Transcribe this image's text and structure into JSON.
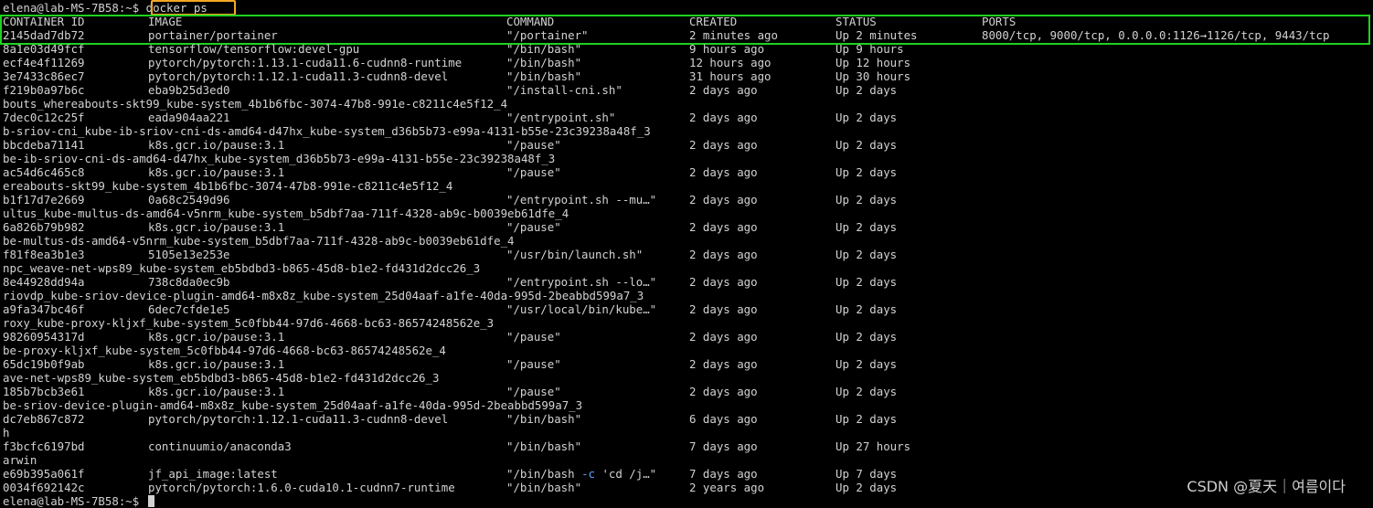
{
  "terminal": {
    "prompt": "elena@lab-MS-7B58:~$ ",
    "command": "docker ps",
    "final_prompt": "elena@lab-MS-7B58:~$ "
  },
  "table": {
    "headers": [
      "CONTAINER ID",
      "IMAGE",
      "COMMAND",
      "CREATED",
      "STATUS",
      "PORTS"
    ],
    "lines": [
      {
        "kind": "row",
        "id": "2145dad7db72",
        "image": "portainer/portainer",
        "command": "\"/portainer\"",
        "created": "2 minutes ago",
        "status": "Up 2 minutes",
        "ports": "8000/tcp, 9000/tcp, 0.0.0.0:1126→1126/tcp, 9443/tcp"
      },
      {
        "kind": "row",
        "id": "8a1e03d49fcf",
        "image": "tensorflow/tensorflow:devel-gpu",
        "command": "\"/bin/bash\"",
        "created": "9 hours ago",
        "status": "Up 9 hours",
        "ports": ""
      },
      {
        "kind": "row",
        "id": "ecf4e4f11269",
        "image": "pytorch/pytorch:1.13.1-cuda11.6-cudnn8-runtime",
        "command": "\"/bin/bash\"",
        "created": "12 hours ago",
        "status": "Up 12 hours",
        "ports": ""
      },
      {
        "kind": "row",
        "id": "3e7433c86ec7",
        "image": "pytorch/pytorch:1.12.1-cuda11.3-cudnn8-devel",
        "command": "\"/bin/bash\"",
        "created": "31 hours ago",
        "status": "Up 30 hours",
        "ports": ""
      },
      {
        "kind": "row",
        "id": "f219b0a97b6c",
        "image": "eba9b25d3ed0",
        "command": "\"/install-cni.sh\"",
        "created": "2 days ago",
        "status": "Up 2 days",
        "ports": ""
      },
      {
        "kind": "wrap",
        "text": "bouts_whereabouts-skt99_kube-system_4b1b6fbc-3074-47b8-991e-c8211c4e5f12_4"
      },
      {
        "kind": "row",
        "id": "7dec0c12c25f",
        "image": "eada904aa221",
        "command": "\"/entrypoint.sh\"",
        "created": "2 days ago",
        "status": "Up 2 days",
        "ports": ""
      },
      {
        "kind": "wrap",
        "text": "b-sriov-cni_kube-ib-sriov-cni-ds-amd64-d47hx_kube-system_d36b5b73-e99a-4131-b55e-23c39238a48f_3"
      },
      {
        "kind": "row",
        "id": "bbcdeba71141",
        "image": "k8s.gcr.io/pause:3.1",
        "command": "\"/pause\"",
        "created": "2 days ago",
        "status": "Up 2 days",
        "ports": ""
      },
      {
        "kind": "wrap",
        "text": "be-ib-sriov-cni-ds-amd64-d47hx_kube-system_d36b5b73-e99a-4131-b55e-23c39238a48f_3"
      },
      {
        "kind": "row",
        "id": "ac54d6c465c8",
        "image": "k8s.gcr.io/pause:3.1",
        "command": "\"/pause\"",
        "created": "2 days ago",
        "status": "Up 2 days",
        "ports": ""
      },
      {
        "kind": "wrap",
        "text": "ereabouts-skt99_kube-system_4b1b6fbc-3074-47b8-991e-c8211c4e5f12_4"
      },
      {
        "kind": "row",
        "id": "b1f17d7e2669",
        "image": "0a68c2549d96",
        "command": "\"/entrypoint.sh --mu…\"",
        "created": "2 days ago",
        "status": "Up 2 days",
        "ports": ""
      },
      {
        "kind": "wrap",
        "text": "ultus_kube-multus-ds-amd64-v5nrm_kube-system_b5dbf7aa-711f-4328-ab9c-b0039eb61dfe_4"
      },
      {
        "kind": "row",
        "id": "6a826b79b982",
        "image": "k8s.gcr.io/pause:3.1",
        "command": "\"/pause\"",
        "created": "2 days ago",
        "status": "Up 2 days",
        "ports": ""
      },
      {
        "kind": "wrap",
        "text": "be-multus-ds-amd64-v5nrm_kube-system_b5dbf7aa-711f-4328-ab9c-b0039eb61dfe_4"
      },
      {
        "kind": "row",
        "id": "f81f8ea3b1e3",
        "image": "5105e13e253e",
        "command": "\"/usr/bin/launch.sh\"",
        "created": "2 days ago",
        "status": "Up 2 days",
        "ports": ""
      },
      {
        "kind": "wrap",
        "text": "npc_weave-net-wps89_kube-system_eb5bdbd3-b865-45d8-b1e2-fd431d2dcc26_3"
      },
      {
        "kind": "row",
        "id": "8e44928dd94a",
        "image": "738c8da0ec9b",
        "command": "\"/entrypoint.sh --lo…\"",
        "created": "2 days ago",
        "status": "Up 2 days",
        "ports": ""
      },
      {
        "kind": "wrap",
        "text": "riovdp_kube-sriov-device-plugin-amd64-m8x8z_kube-system_25d04aaf-a1fe-40da-995d-2beabbd599a7_3"
      },
      {
        "kind": "row",
        "id": "a9fa347bc46f",
        "image": "6dec7cfde1e5",
        "command": "\"/usr/local/bin/kube…\"",
        "created": "2 days ago",
        "status": "Up 2 days",
        "ports": ""
      },
      {
        "kind": "wrap",
        "text": "roxy_kube-proxy-kljxf_kube-system_5c0fbb44-97d6-4668-bc63-86574248562e_3"
      },
      {
        "kind": "row",
        "id": "98260954317d",
        "image": "k8s.gcr.io/pause:3.1",
        "command": "\"/pause\"",
        "created": "2 days ago",
        "status": "Up 2 days",
        "ports": ""
      },
      {
        "kind": "wrap",
        "text": "be-proxy-kljxf_kube-system_5c0fbb44-97d6-4668-bc63-86574248562e_4"
      },
      {
        "kind": "row",
        "id": "65dc19b0f9ab",
        "image": "k8s.gcr.io/pause:3.1",
        "command": "\"/pause\"",
        "created": "2 days ago",
        "status": "Up 2 days",
        "ports": ""
      },
      {
        "kind": "wrap",
        "text": "ave-net-wps89_kube-system_eb5bdbd3-b865-45d8-b1e2-fd431d2dcc26_3"
      },
      {
        "kind": "row",
        "id": "185b7bcb3e61",
        "image": "k8s.gcr.io/pause:3.1",
        "command": "\"/pause\"",
        "created": "2 days ago",
        "status": "Up 2 days",
        "ports": ""
      },
      {
        "kind": "wrap",
        "text": "be-sriov-device-plugin-amd64-m8x8z_kube-system_25d04aaf-a1fe-40da-995d-2beabbd599a7_3"
      },
      {
        "kind": "row",
        "id": "dc7eb867c872",
        "image": "pytorch/pytorch:1.12.1-cuda11.3-cudnn8-devel",
        "command": "\"/bin/bash\"",
        "created": "6 days ago",
        "status": "Up 2 days",
        "ports": ""
      },
      {
        "kind": "wrap",
        "text": "h"
      },
      {
        "kind": "row",
        "id": "f3bcfc6197bd",
        "image": "continuumio/anaconda3",
        "command": "\"/bin/bash\"",
        "created": "7 days ago",
        "status": "Up 27 hours",
        "ports": ""
      },
      {
        "kind": "wrap",
        "text": "arwin"
      },
      {
        "kind": "row",
        "id": "e69b395a061f",
        "image": "jf_api_image:latest",
        "command_pre": "\"/bin/bash ",
        "command_flag": "-c",
        "command_post": " 'cd /j…\"",
        "created": "7 days ago",
        "status": "Up 7 days",
        "ports": ""
      },
      {
        "kind": "row",
        "id": "0034f692142c",
        "image": "pytorch/pytorch:1.6.0-cuda10.1-cudnn7-runtime",
        "command": "\"/bin/bash\"",
        "created": "2 years ago",
        "status": "Up 2 days",
        "ports": ""
      }
    ]
  },
  "watermark": "CSDN @夏天｜여름이다",
  "colors": {
    "background": "#000000",
    "text": "#d2d2d2",
    "command_highlight": "#f5a623",
    "row_highlight": "#1fd11f",
    "flag": "#5fa0ff"
  }
}
